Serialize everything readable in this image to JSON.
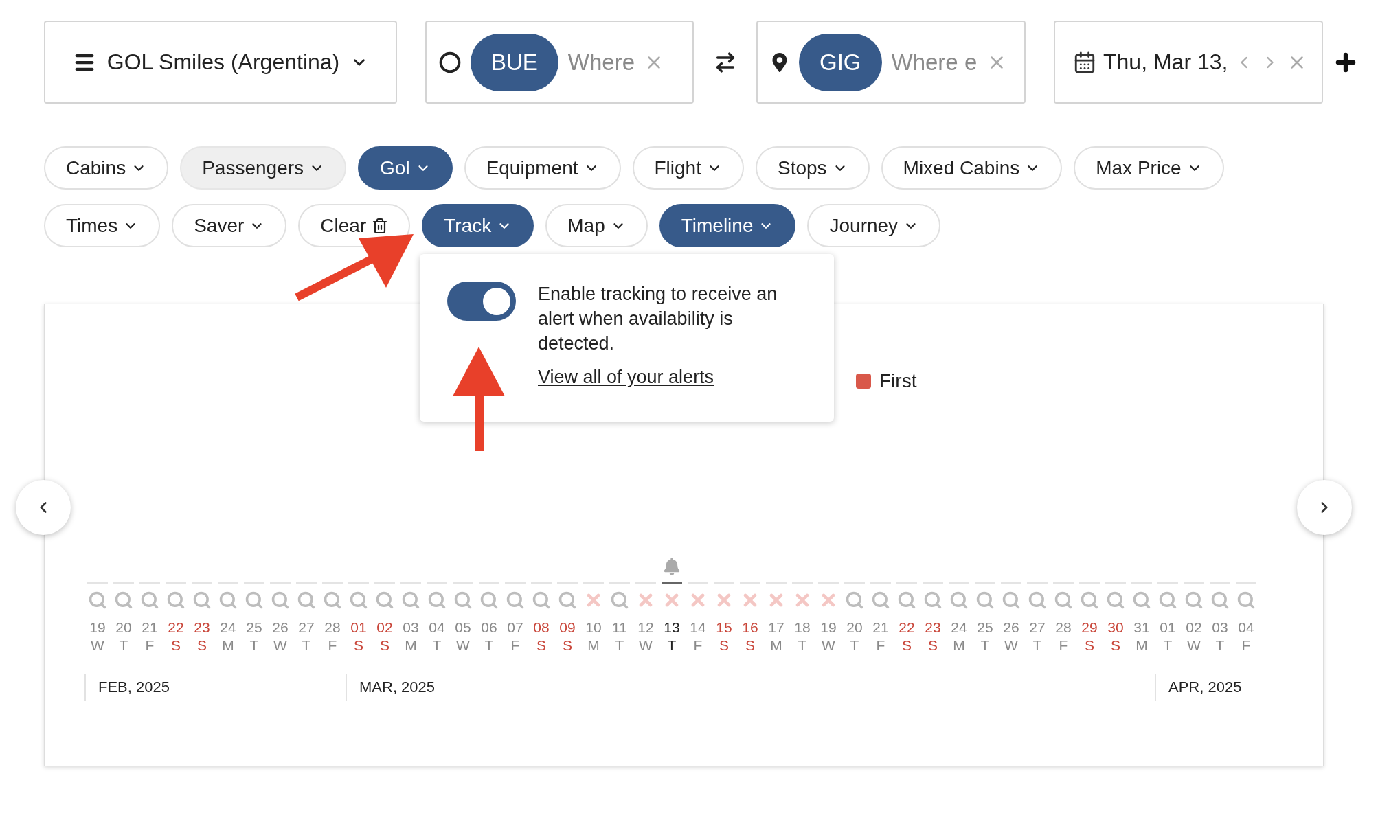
{
  "program": {
    "label": "GOL Smiles (Argentina)"
  },
  "origin": {
    "code": "BUE",
    "placeholder": "Where"
  },
  "destination": {
    "code": "GIG",
    "placeholder": "Where e"
  },
  "date": {
    "value": "Thu, Mar 13,"
  },
  "filters": [
    {
      "chips": [
        {
          "label": "Cabins",
          "kind": "dropdown",
          "selected": false,
          "highlighted": false
        },
        {
          "label": "Passengers",
          "kind": "dropdown",
          "selected": false,
          "highlighted": true
        },
        {
          "label": "Gol",
          "kind": "dropdown",
          "selected": true,
          "highlighted": false
        },
        {
          "label": "Equipment",
          "kind": "dropdown",
          "selected": false,
          "highlighted": false
        },
        {
          "label": "Flight",
          "kind": "dropdown",
          "selected": false,
          "highlighted": false
        },
        {
          "label": "Stops",
          "kind": "dropdown",
          "selected": false,
          "highlighted": false
        },
        {
          "label": "Mixed Cabins",
          "kind": "dropdown",
          "selected": false,
          "highlighted": false
        },
        {
          "label": "Max Price",
          "kind": "dropdown",
          "selected": false,
          "highlighted": false
        }
      ]
    },
    {
      "chips": [
        {
          "label": "Times",
          "kind": "dropdown",
          "selected": false,
          "highlighted": false
        },
        {
          "label": "Saver",
          "kind": "dropdown",
          "selected": false,
          "highlighted": false
        },
        {
          "label": "Clear",
          "kind": "action",
          "selected": false,
          "highlighted": false
        },
        {
          "label": "Track",
          "kind": "dropdown",
          "selected": true,
          "highlighted": false
        },
        {
          "label": "Map",
          "kind": "dropdown",
          "selected": false,
          "highlighted": false
        },
        {
          "label": "Timeline",
          "kind": "dropdown",
          "selected": true,
          "highlighted": false
        },
        {
          "label": "Journey",
          "kind": "dropdown",
          "selected": false,
          "highlighted": false
        }
      ]
    }
  ],
  "tracking_popover": {
    "on": true,
    "text": "Enable tracking to receive an alert when availability is detected.",
    "link": "View all of your alerts"
  },
  "legend": [
    {
      "label": "First",
      "color": "#d9584a"
    }
  ],
  "timeline": {
    "months": [
      {
        "label": "FEB, 2025",
        "days": [
          {
            "day": "19",
            "weekday": "W",
            "weekend": false,
            "kind": "search",
            "selected": false
          },
          {
            "day": "20",
            "weekday": "T",
            "weekend": false,
            "kind": "search",
            "selected": false
          },
          {
            "day": "21",
            "weekday": "F",
            "weekend": false,
            "kind": "search",
            "selected": false
          },
          {
            "day": "22",
            "weekday": "S",
            "weekend": true,
            "kind": "search",
            "selected": false
          },
          {
            "day": "23",
            "weekday": "S",
            "weekend": true,
            "kind": "search",
            "selected": false
          },
          {
            "day": "24",
            "weekday": "M",
            "weekend": false,
            "kind": "search",
            "selected": false
          },
          {
            "day": "25",
            "weekday": "T",
            "weekend": false,
            "kind": "search",
            "selected": false
          },
          {
            "day": "26",
            "weekday": "W",
            "weekend": false,
            "kind": "search",
            "selected": false
          },
          {
            "day": "27",
            "weekday": "T",
            "weekend": false,
            "kind": "search",
            "selected": false
          },
          {
            "day": "28",
            "weekday": "F",
            "weekend": false,
            "kind": "search",
            "selected": false
          }
        ]
      },
      {
        "label": "MAR, 2025",
        "days": [
          {
            "day": "01",
            "weekday": "S",
            "weekend": true,
            "kind": "search",
            "selected": false
          },
          {
            "day": "02",
            "weekday": "S",
            "weekend": true,
            "kind": "search",
            "selected": false
          },
          {
            "day": "03",
            "weekday": "M",
            "weekend": false,
            "kind": "search",
            "selected": false
          },
          {
            "day": "04",
            "weekday": "T",
            "weekend": false,
            "kind": "search",
            "selected": false
          },
          {
            "day": "05",
            "weekday": "W",
            "weekend": false,
            "kind": "search",
            "selected": false
          },
          {
            "day": "06",
            "weekday": "T",
            "weekend": false,
            "kind": "search",
            "selected": false
          },
          {
            "day": "07",
            "weekday": "F",
            "weekend": false,
            "kind": "search",
            "selected": false
          },
          {
            "day": "08",
            "weekday": "S",
            "weekend": true,
            "kind": "search",
            "selected": false
          },
          {
            "day": "09",
            "weekday": "S",
            "weekend": true,
            "kind": "search",
            "selected": false
          },
          {
            "day": "10",
            "weekday": "M",
            "weekend": false,
            "kind": "unavailable",
            "selected": false
          },
          {
            "day": "11",
            "weekday": "T",
            "weekend": false,
            "kind": "search",
            "selected": false
          },
          {
            "day": "12",
            "weekday": "W",
            "weekend": false,
            "kind": "unavailable",
            "selected": false
          },
          {
            "day": "13",
            "weekday": "T",
            "weekend": false,
            "kind": "unavailable",
            "selected": true
          },
          {
            "day": "14",
            "weekday": "F",
            "weekend": false,
            "kind": "unavailable",
            "selected": false
          },
          {
            "day": "15",
            "weekday": "S",
            "weekend": true,
            "kind": "unavailable",
            "selected": false
          },
          {
            "day": "16",
            "weekday": "S",
            "weekend": true,
            "kind": "unavailable",
            "selected": false
          },
          {
            "day": "17",
            "weekday": "M",
            "weekend": false,
            "kind": "unavailable",
            "selected": false
          },
          {
            "day": "18",
            "weekday": "T",
            "weekend": false,
            "kind": "unavailable",
            "selected": false
          },
          {
            "day": "19",
            "weekday": "W",
            "weekend": false,
            "kind": "unavailable",
            "selected": false
          },
          {
            "day": "20",
            "weekday": "T",
            "weekend": false,
            "kind": "search",
            "selected": false
          },
          {
            "day": "21",
            "weekday": "F",
            "weekend": false,
            "kind": "search",
            "selected": false
          },
          {
            "day": "22",
            "weekday": "S",
            "weekend": true,
            "kind": "search",
            "selected": false
          },
          {
            "day": "23",
            "weekday": "S",
            "weekend": true,
            "kind": "search",
            "selected": false
          },
          {
            "day": "24",
            "weekday": "M",
            "weekend": false,
            "kind": "search",
            "selected": false
          },
          {
            "day": "25",
            "weekday": "T",
            "weekend": false,
            "kind": "search",
            "selected": false
          },
          {
            "day": "26",
            "weekday": "W",
            "weekend": false,
            "kind": "search",
            "selected": false
          },
          {
            "day": "27",
            "weekday": "T",
            "weekend": false,
            "kind": "search",
            "selected": false
          },
          {
            "day": "28",
            "weekday": "F",
            "weekend": false,
            "kind": "search",
            "selected": false
          },
          {
            "day": "29",
            "weekday": "S",
            "weekend": true,
            "kind": "search",
            "selected": false
          },
          {
            "day": "30",
            "weekday": "S",
            "weekend": true,
            "kind": "search",
            "selected": false
          },
          {
            "day": "31",
            "weekday": "M",
            "weekend": false,
            "kind": "search",
            "selected": false
          }
        ]
      },
      {
        "label": "APR, 2025",
        "days": [
          {
            "day": "01",
            "weekday": "T",
            "weekend": false,
            "kind": "search",
            "selected": false
          },
          {
            "day": "02",
            "weekday": "W",
            "weekend": false,
            "kind": "search",
            "selected": false
          },
          {
            "day": "03",
            "weekday": "T",
            "weekend": false,
            "kind": "search",
            "selected": false
          },
          {
            "day": "04",
            "weekday": "F",
            "weekend": false,
            "kind": "search",
            "selected": false
          }
        ]
      }
    ]
  }
}
